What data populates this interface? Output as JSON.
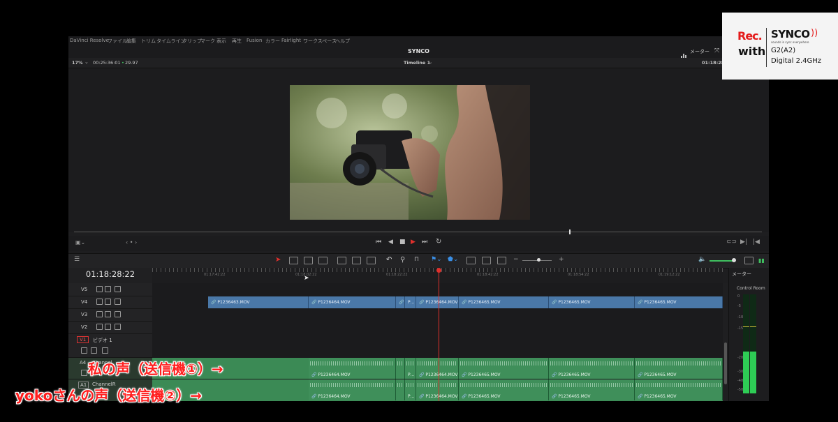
{
  "app": {
    "menu_items": [
      "DaVinci Resolve",
      "ファイル",
      "編集",
      "トリム",
      "タイムライン",
      "クリップ",
      "マーク",
      "表示",
      "再生",
      "Fusion",
      "カラー",
      "Fairlight",
      "ワークスペース",
      "ヘルプ"
    ],
    "project_title": "SYNCO",
    "meters_label": "メーター"
  },
  "viewer": {
    "zoom": "17%",
    "source_timecode": "00:25:36:01",
    "fps": "29.97",
    "timeline_name": "Timeline 1",
    "record_timecode": "01:18:28:22"
  },
  "timeline": {
    "current_timecode": "01:18:28:22",
    "ruler_ticks": [
      "01:17:42:22",
      "01:18:02:22",
      "01:18:22:22",
      "01:18:42:22",
      "01:18:54:22",
      "01:19:12:22"
    ],
    "video_tracks": [
      {
        "name": "V5"
      },
      {
        "name": "V4"
      },
      {
        "name": "V3"
      },
      {
        "name": "V2"
      }
    ],
    "v1": {
      "name": "V1",
      "label": "ビデオ 1"
    },
    "audio_tracks": [
      {
        "name": "A4",
        "label": "Channel"
      },
      {
        "name": "A1",
        "label": "ChannelR"
      }
    ],
    "v4_clips": [
      "P1236463.MOV",
      "P1236464.MOV",
      "P…",
      "P1236464.MOV",
      "P1236465.MOV",
      "P1236465.MOV",
      "P1236465.MOV"
    ],
    "a_clips": [
      "P1236464.MOV",
      "P…",
      "P1236464.MOV",
      "P1236465.MOV",
      "P1236465.MOV",
      "P1236465.MOV"
    ]
  },
  "meters": {
    "panel_title": "メーター",
    "control_room": "Control Room",
    "scale": [
      "0",
      "-5",
      "-10",
      "-15",
      "-20",
      "-30",
      "-40",
      "-50"
    ],
    "level": 0.42
  },
  "overlay": {
    "rec": "Rec.",
    "with": "with",
    "brand": "SYNCO",
    "tagline": "sounds in sync everywhere",
    "model": "G2(A2)",
    "spec": "Digital 2.4GHz"
  },
  "annotations": {
    "line1": "私の声（送信機①）→",
    "line2": "yokoさんの声（送信機②）→"
  },
  "colors": {
    "video_clip": "#4a78a8",
    "audio_clip": "#3f8f5a",
    "playhead": "#e0302c",
    "annotation": "#ff1e1e"
  }
}
